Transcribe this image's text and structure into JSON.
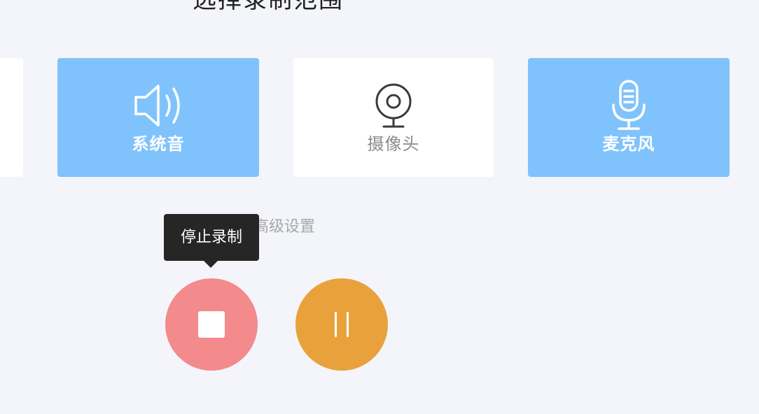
{
  "header": {
    "title": "选择录制范围"
  },
  "sources": {
    "system_audio": {
      "label": "系统音",
      "active": true,
      "icon": "speaker-icon"
    },
    "camera": {
      "label": "摄像头",
      "active": false,
      "icon": "webcam-icon"
    },
    "microphone": {
      "label": "麦克风",
      "active": true,
      "icon": "microphone-icon"
    }
  },
  "advanced_settings": {
    "label": "高级设置"
  },
  "controls": {
    "stop": {
      "tooltip": "停止录制",
      "icon": "stop-icon"
    },
    "pause": {
      "icon": "pause-icon"
    }
  },
  "colors": {
    "page_background": "#f4f5fa",
    "active_card": "#80c3fc",
    "inactive_card": "#ffffff",
    "stop_button": "#f38a8c",
    "pause_button": "#e9a23b",
    "tooltip_background": "#262626"
  }
}
